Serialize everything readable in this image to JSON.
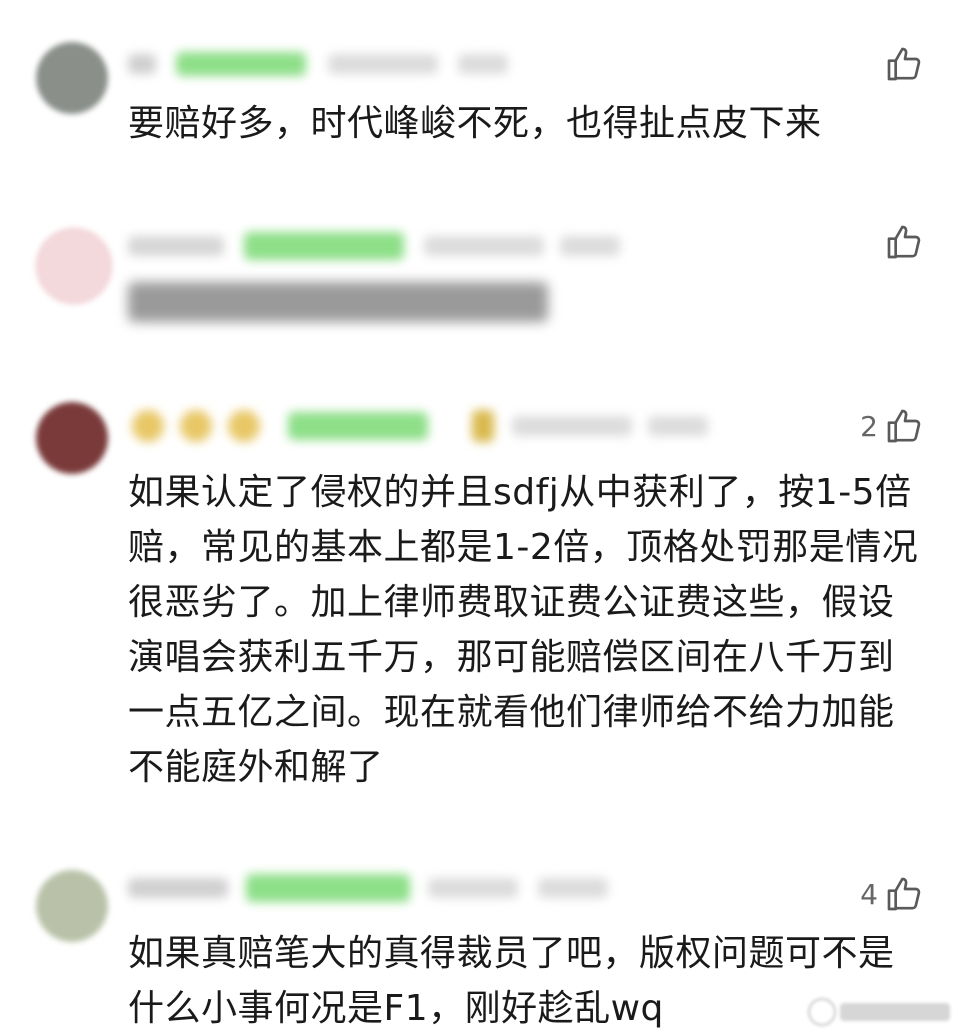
{
  "comments": [
    {
      "text": "要赔好多，时代峰峻不死，也得扯点皮下来",
      "likes": "",
      "avatar_color": "#8a8f8a"
    },
    {
      "text": "",
      "likes": "",
      "avatar_color": "#f3d9dc"
    },
    {
      "text": "如果认定了侵权的并且sdfj从中获利了，按1-5倍赔，常见的基本上都是1-2倍，顶格处罚那是情况很恶劣了。加上律师费取证费公证费这些，假设演唱会获利五千万，那可能赔偿区间在八千万到一点五亿之间。现在就看他们律师给不给力加能不能庭外和解了",
      "likes": "2",
      "avatar_color": "#7a3a3a"
    },
    {
      "text": "如果真赔笔大的真得裁员了吧，版权问题可不是什么小事何况是F1，刚好趁乱wq",
      "likes": "4",
      "avatar_color": "#b9c2a8"
    }
  ],
  "colors": {
    "badge_green": "#7ed87a",
    "meta_gray": "#c9c9c9",
    "text": "#1a1a1a",
    "like": "#666666"
  },
  "icons": {
    "like": "thumbs-up-icon"
  }
}
